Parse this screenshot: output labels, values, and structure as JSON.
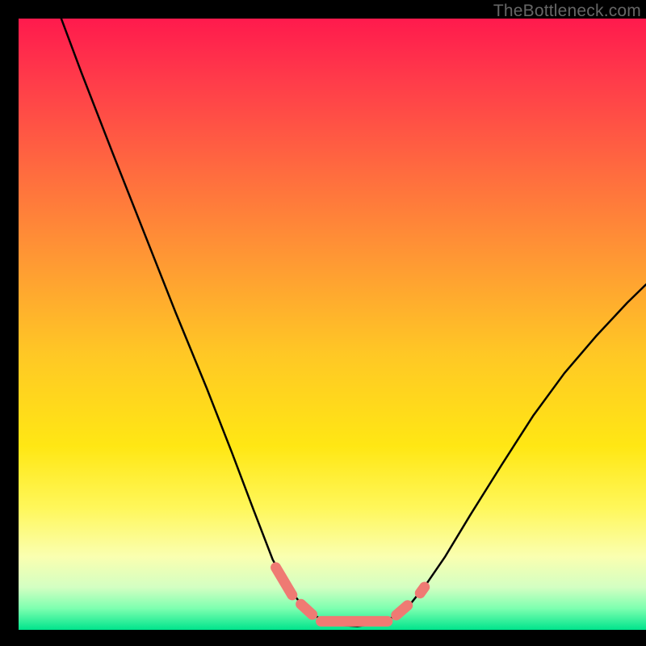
{
  "watermark": "TheBottleneck.com",
  "chart_data": {
    "type": "line",
    "title": "",
    "xlabel": "",
    "ylabel": "",
    "xlim": [
      0,
      1
    ],
    "ylim": [
      0,
      1
    ],
    "background_gradient": {
      "stops": [
        {
          "pos": 0.0,
          "color": "#ff1a4d"
        },
        {
          "pos": 0.1,
          "color": "#ff3b4a"
        },
        {
          "pos": 0.25,
          "color": "#ff6b3f"
        },
        {
          "pos": 0.4,
          "color": "#ff9a33"
        },
        {
          "pos": 0.55,
          "color": "#ffc825"
        },
        {
          "pos": 0.7,
          "color": "#ffe714"
        },
        {
          "pos": 0.8,
          "color": "#fff75a"
        },
        {
          "pos": 0.88,
          "color": "#faffb0"
        },
        {
          "pos": 0.93,
          "color": "#d4ffc2"
        },
        {
          "pos": 0.965,
          "color": "#7dffb0"
        },
        {
          "pos": 1.0,
          "color": "#00e48c"
        }
      ]
    },
    "series": [
      {
        "name": "curve",
        "stroke": "#000000",
        "points": [
          {
            "x": 0.068,
            "y": 1.0
          },
          {
            "x": 0.1,
            "y": 0.912
          },
          {
            "x": 0.15,
            "y": 0.78
          },
          {
            "x": 0.2,
            "y": 0.65
          },
          {
            "x": 0.25,
            "y": 0.52
          },
          {
            "x": 0.3,
            "y": 0.395
          },
          {
            "x": 0.34,
            "y": 0.29
          },
          {
            "x": 0.375,
            "y": 0.195
          },
          {
            "x": 0.405,
            "y": 0.115
          },
          {
            "x": 0.43,
            "y": 0.068
          },
          {
            "x": 0.455,
            "y": 0.037
          },
          {
            "x": 0.48,
            "y": 0.018
          },
          {
            "x": 0.51,
            "y": 0.008
          },
          {
            "x": 0.54,
            "y": 0.006
          },
          {
            "x": 0.57,
            "y": 0.01
          },
          {
            "x": 0.6,
            "y": 0.022
          },
          {
            "x": 0.625,
            "y": 0.043
          },
          {
            "x": 0.65,
            "y": 0.075
          },
          {
            "x": 0.68,
            "y": 0.12
          },
          {
            "x": 0.72,
            "y": 0.188
          },
          {
            "x": 0.77,
            "y": 0.27
          },
          {
            "x": 0.82,
            "y": 0.35
          },
          {
            "x": 0.87,
            "y": 0.42
          },
          {
            "x": 0.92,
            "y": 0.48
          },
          {
            "x": 0.97,
            "y": 0.535
          },
          {
            "x": 1.0,
            "y": 0.565
          }
        ]
      },
      {
        "name": "bottom-markers",
        "stroke": "#ef7a73",
        "segments": [
          {
            "x1": 0.41,
            "y1": 0.102,
            "x2": 0.436,
            "y2": 0.057
          },
          {
            "x1": 0.45,
            "y1": 0.042,
            "x2": 0.468,
            "y2": 0.025
          },
          {
            "x1": 0.482,
            "y1": 0.014,
            "x2": 0.588,
            "y2": 0.014
          },
          {
            "x1": 0.602,
            "y1": 0.024,
            "x2": 0.62,
            "y2": 0.04
          },
          {
            "x1": 0.64,
            "y1": 0.06,
            "x2": 0.647,
            "y2": 0.07
          }
        ]
      }
    ]
  }
}
